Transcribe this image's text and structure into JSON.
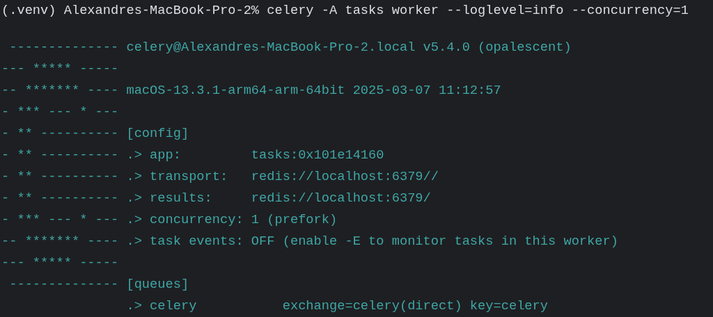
{
  "terminal": {
    "prompt_line": "(.venv) Alexandres-MacBook-Pro-2% celery -A tasks worker --loglevel=info --concurrency=1",
    "output_lines": [
      " -------------- celery@Alexandres-MacBook-Pro-2.local v5.4.0 (opalescent)",
      "--- ***** -----",
      "-- ******* ---- macOS-13.3.1-arm64-arm-64bit 2025-03-07 11:12:57",
      "- *** --- * ---",
      "- ** ---------- [config]",
      "- ** ---------- .> app:         tasks:0x101e14160",
      "- ** ---------- .> transport:   redis://localhost:6379//",
      "- ** ---------- .> results:     redis://localhost:6379/",
      "- *** --- * --- .> concurrency: 1 (prefork)",
      "-- ******* ---- .> task events: OFF (enable -E to monitor tasks in this worker)",
      "--- ***** -----",
      " -------------- [queues]",
      "                .> celery           exchange=celery(direct) key=celery"
    ]
  }
}
